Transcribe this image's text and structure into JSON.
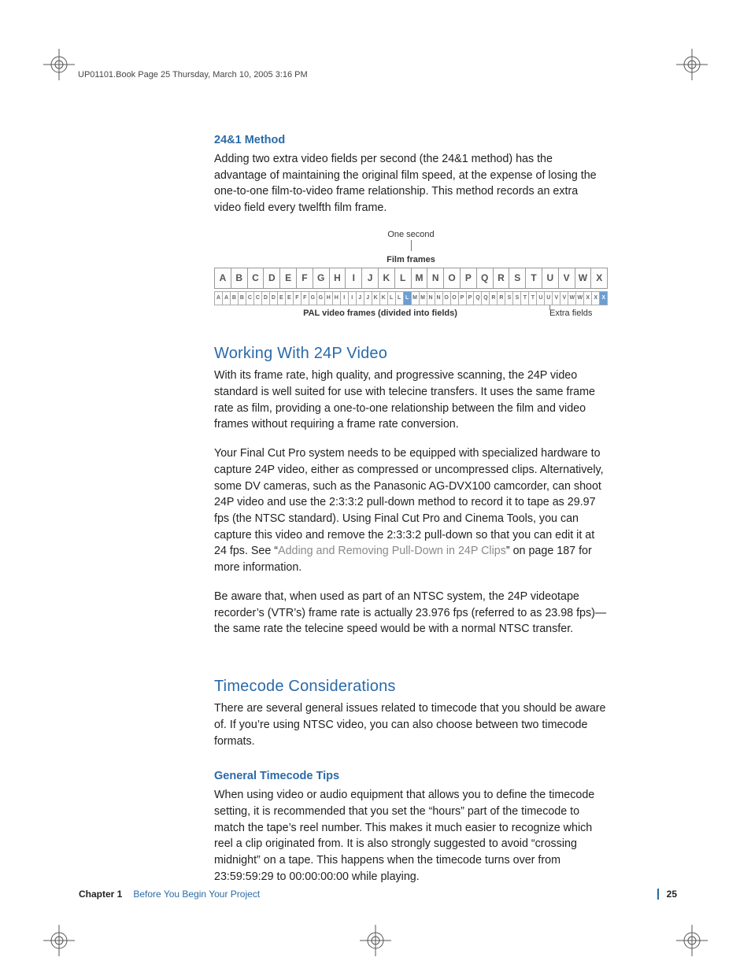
{
  "header_line": "UP01101.Book  Page 25  Thursday, March 10, 2005  3:16 PM",
  "section1": {
    "title": "24&1 Method",
    "body": "Adding two extra video fields per second (the 24&1 method) has the advantage of maintaining the original film speed, at the expense of losing the one-to-one film-to-video frame relationship. This method records an extra video field every twelfth film frame."
  },
  "diagram": {
    "one_second": "One second",
    "film_frames_label": "Film frames",
    "film_row": [
      "A",
      "B",
      "C",
      "D",
      "E",
      "F",
      "G",
      "H",
      "I",
      "J",
      "K",
      "L",
      "M",
      "N",
      "O",
      "P",
      "Q",
      "R",
      "S",
      "T",
      "U",
      "V",
      "W",
      "X"
    ],
    "field_row": [
      "A",
      "A",
      "B",
      "B",
      "C",
      "C",
      "D",
      "D",
      "E",
      "E",
      "F",
      "F",
      "G",
      "G",
      "H",
      "H",
      "I",
      "I",
      "J",
      "J",
      "K",
      "K",
      "L",
      "L",
      "L",
      "M",
      "M",
      "N",
      "N",
      "O",
      "O",
      "P",
      "P",
      "Q",
      "Q",
      "R",
      "R",
      "S",
      "S",
      "T",
      "T",
      "U",
      "U",
      "V",
      "V",
      "W",
      "W",
      "X",
      "X",
      "X"
    ],
    "extra_indices": [
      24,
      49
    ],
    "pal_label": "PAL video frames (divided into fields)",
    "extra_label": "Extra fields"
  },
  "section2": {
    "title": "Working With 24P Video",
    "p1": "With its frame rate, high quality, and progressive scanning, the 24P video standard is well suited for use with telecine transfers. It uses the same frame rate as film, providing a one-to-one relationship between the film and video frames without requiring a frame rate conversion.",
    "p2a": "Your Final Cut Pro system needs to be equipped with specialized hardware to capture 24P video, either as compressed or uncompressed clips. Alternatively, some DV cameras, such as the Panasonic AG-DVX100 camcorder, can shoot 24P video and use the 2:3:3:2 pull-down method to record it to tape as 29.97 fps (the NTSC standard). Using Final Cut Pro and Cinema Tools, you can capture this video and remove the 2:3:3:2 pull-down so that you can edit it at 24 fps. See “",
    "p2link": "Adding and Removing Pull-Down in 24P Clips",
    "p2b": "” on page 187 for more information.",
    "p3": "Be aware that, when used as part of an NTSC system, the 24P videotape recorder’s (VTR’s) frame rate is actually 23.976 fps (referred to as 23.98 fps)—the same rate the telecine speed would be with a normal NTSC transfer."
  },
  "section3": {
    "title": "Timecode Considerations",
    "p1": "There are several general issues related to timecode that you should be aware of. If you’re using NTSC video, you can also choose between two timecode formats."
  },
  "section4": {
    "title": "General Timecode Tips",
    "p1": "When using video or audio equipment that allows you to define the timecode setting, it is recommended that you set the “hours” part of the timecode to match the tape’s reel number. This makes it much easier to recognize which reel a clip originated from. It is also strongly suggested to avoid “crossing midnight” on a tape. This happens when the timecode turns over from 23:59:59:29 to 00:00:00:00 while playing."
  },
  "footer": {
    "chapter_label": "Chapter 1",
    "chapter_name": "Before You Begin Your Project",
    "page": "25"
  }
}
